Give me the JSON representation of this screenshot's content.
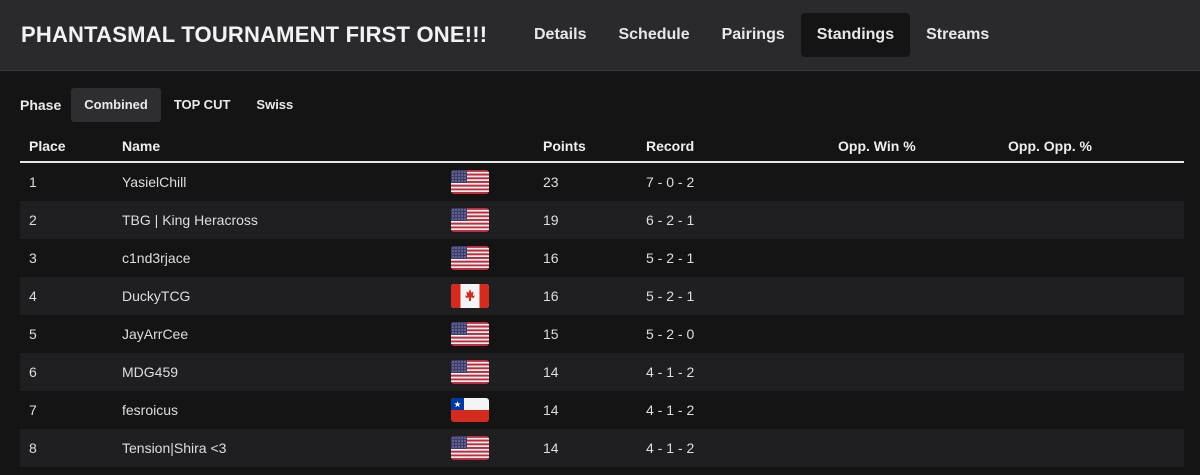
{
  "header": {
    "title": "PHANTASMAL TOURNAMENT FIRST ONE!!!",
    "tabs": [
      {
        "label": "Details",
        "active": false
      },
      {
        "label": "Schedule",
        "active": false
      },
      {
        "label": "Pairings",
        "active": false
      },
      {
        "label": "Standings",
        "active": true
      },
      {
        "label": "Streams",
        "active": false
      }
    ]
  },
  "phase": {
    "label": "Phase",
    "options": [
      {
        "label": "Combined",
        "active": true
      },
      {
        "label": "TOP CUT",
        "active": false
      },
      {
        "label": "Swiss",
        "active": false
      }
    ]
  },
  "standings": {
    "columns": {
      "place": "Place",
      "name": "Name",
      "points": "Points",
      "record": "Record",
      "opp_win": "Opp. Win %",
      "opp_opp": "Opp. Opp. %"
    },
    "rows": [
      {
        "place": "1",
        "name": "YasielChill",
        "country": "us-flag-icon",
        "points": "23",
        "record": "7 - 0 - 2"
      },
      {
        "place": "2",
        "name": "TBG | King Heracross",
        "country": "us-flag-icon",
        "points": "19",
        "record": "6 - 2 - 1"
      },
      {
        "place": "3",
        "name": "c1nd3rjace",
        "country": "us-flag-icon",
        "points": "16",
        "record": "5 - 2 - 1"
      },
      {
        "place": "4",
        "name": "DuckyTCG",
        "country": "canada-flag-icon",
        "points": "16",
        "record": "5 - 2 - 1"
      },
      {
        "place": "5",
        "name": "JayArrCee",
        "country": "us-flag-icon",
        "points": "15",
        "record": "5 - 2 - 0"
      },
      {
        "place": "6",
        "name": "MDG459",
        "country": "us-flag-icon",
        "points": "14",
        "record": "4 - 1 - 2"
      },
      {
        "place": "7",
        "name": "fesroicus",
        "country": "chile-flag-icon",
        "points": "14",
        "record": "4 - 1 - 2"
      },
      {
        "place": "8",
        "name": "Tension|Shira <3",
        "country": "us-flag-icon",
        "points": "14",
        "record": "4 - 1 - 2"
      }
    ]
  },
  "colors": {
    "background": "#141414",
    "header_bg": "#2a2a2c",
    "row_alt": "#1f1f21",
    "text": "#e6e6e6"
  }
}
